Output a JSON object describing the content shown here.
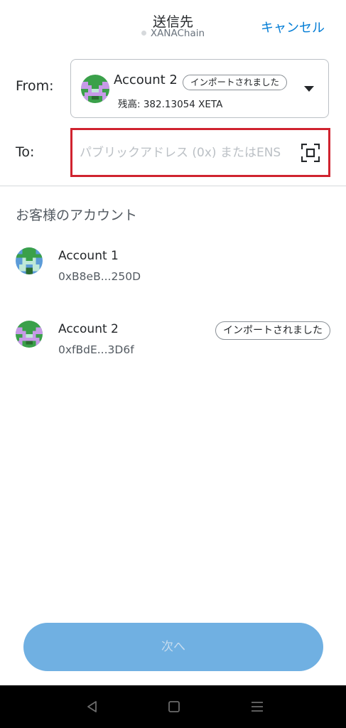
{
  "header": {
    "title": "送信先",
    "network": "XANAChain",
    "cancel_label": "キャンセル"
  },
  "from": {
    "label": "From:",
    "account_name": "Account 2",
    "badge": "インポートされました",
    "balance": "残高: 382.13054 XETA"
  },
  "to": {
    "label": "To:",
    "placeholder": "パブリックアドレス (0x) またはENS"
  },
  "accounts_section": {
    "title": "お客様のアカウント",
    "items": [
      {
        "name": "Account 1",
        "address": "0xB8eB...250D",
        "badge": ""
      },
      {
        "name": "Account 2",
        "address": "0xfBdE...3D6f",
        "badge": "インポートされました"
      }
    ]
  },
  "next_button": {
    "label": "次へ"
  },
  "icons": {
    "scan": "qr-scan-icon",
    "caret": "caret-down-icon",
    "nav_back": "back-triangle-icon",
    "nav_home": "home-square-icon",
    "nav_menu": "menu-lines-icon"
  },
  "colors": {
    "accent": "#037dd6",
    "highlight_border": "#d0232f",
    "button_disabled": "#70b0e2"
  }
}
